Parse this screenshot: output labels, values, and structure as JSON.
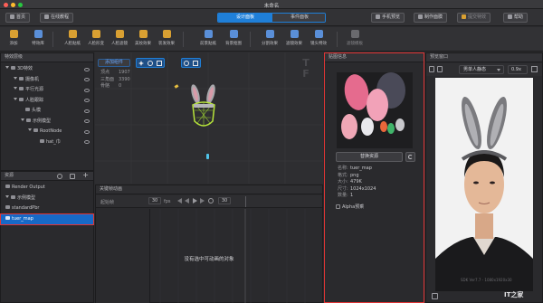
{
  "window": {
    "title": "未命名"
  },
  "topbar": {
    "home": "首页",
    "tutorial": "在线教程",
    "tab_design": "设计面板",
    "tab_event": "事件面板",
    "phone_preview": "手机预览",
    "make_mask": "制作面膜",
    "submit_effect": "提交特效",
    "help": "帮助"
  },
  "toolbar": {
    "items": [
      "添加",
      "特效库",
      "人脸贴纸",
      "人脸形变",
      "人脸滤镜",
      "美妆效果",
      "装发效果",
      "前景贴纸",
      "背景抠图",
      "分割效果",
      "滤镜效果",
      "镜头特效",
      "滤镜模板"
    ]
  },
  "hierarchy": {
    "title": "特效层级",
    "items": [
      {
        "label": "3D特效",
        "indent": 0
      },
      {
        "label": "摄像机",
        "indent": 1
      },
      {
        "label": "平行光源",
        "indent": 1
      },
      {
        "label": "人脸跟踪",
        "indent": 1
      },
      {
        "label": "头模",
        "indent": 2
      },
      {
        "label": "示例模型",
        "indent": 2
      },
      {
        "label": "RootNode",
        "indent": 3
      },
      {
        "label": "hat_巾",
        "indent": 4
      }
    ]
  },
  "resources": {
    "title": "资源",
    "items": [
      "Render Output",
      "示例模型",
      "standardPbr",
      "tuer_map"
    ],
    "selected": "tuer_map"
  },
  "viewport": {
    "add_component": "添加组件",
    "stats": [
      {
        "k": "顶点",
        "v": "1907"
      },
      {
        "k": "三角面",
        "v": "3390"
      },
      {
        "k": "骨骼",
        "v": "0"
      }
    ]
  },
  "keyframe": {
    "title": "关键帧动画",
    "fps_label": "fps",
    "fps_value": "30",
    "frame_value": "30",
    "range_start": "起始帧",
    "empty_message": "没有选中可动画的对象"
  },
  "properties": {
    "title": "贴图信息",
    "replace_button": "替换资源",
    "info": [
      {
        "k": "名称:",
        "v": "tuer_map"
      },
      {
        "k": "格式:",
        "v": "png"
      },
      {
        "k": "大小:",
        "v": "479K"
      },
      {
        "k": "尺寸:",
        "v": "1024x1024"
      },
      {
        "k": "数量:",
        "v": "1"
      }
    ],
    "alpha_label": "Alpha预乘"
  },
  "preview": {
    "title": "预览窗口",
    "model_select": "男单人静态",
    "zoom": "0.9x",
    "footer_text": "SDK Ver7.7 - 1080x1920x30",
    "watermark": "IT之家"
  },
  "colors": {
    "accent": "#1f7fd8",
    "selected_row": "#1769c6",
    "highlight_border": "#e03535",
    "toolbar_icon": "#d9a032"
  }
}
